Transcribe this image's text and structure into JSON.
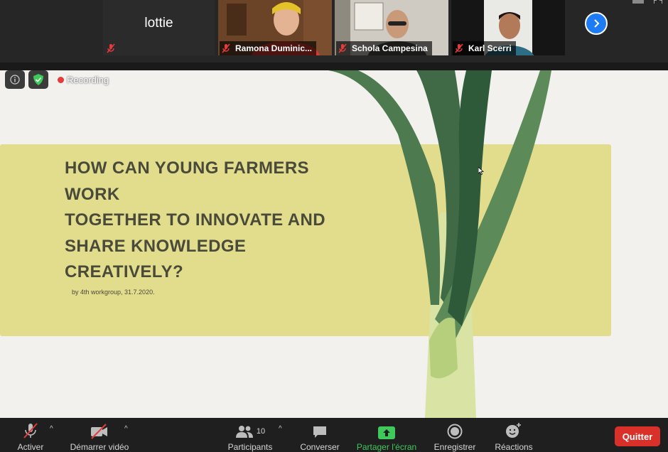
{
  "participants": [
    {
      "name": "lottie",
      "display": "lottie"
    },
    {
      "name": "Ramona Duminic..."
    },
    {
      "name": "Schola Campesina"
    },
    {
      "name": "Karl Scerri"
    }
  ],
  "overlay": {
    "recording_label": "Recording"
  },
  "slide": {
    "title_lines": [
      "HOW CAN YOUNG FARMERS",
      "WORK",
      "TOGETHER TO INNOVATE AND",
      "SHARE KNOWLEDGE",
      "CREATIVELY?"
    ],
    "subtitle": "by 4th workgroup, 31.7.2020."
  },
  "toolbar": {
    "mute_label": "Activer",
    "video_label": "Démarrer vidéo",
    "participants_label": "Participants",
    "participants_count": "10",
    "chat_label": "Converser",
    "share_label": "Partager l'écran",
    "record_label": "Enregistrer",
    "reactions_label": "Réactions",
    "quit_label": "Quitter"
  },
  "colors": {
    "accent_blue": "#1d7bf5",
    "share_green": "#3ec95a",
    "quit_red": "#d9302a",
    "mute_red": "#e53b3b",
    "slide_smear": "#e1dd8c"
  },
  "icons": [
    "microphone-muted-icon",
    "video-off-icon",
    "participants-icon",
    "chat-icon",
    "share-screen-icon",
    "record-icon",
    "reactions-icon",
    "info-icon",
    "shield-icon",
    "chevron-right-icon"
  ]
}
